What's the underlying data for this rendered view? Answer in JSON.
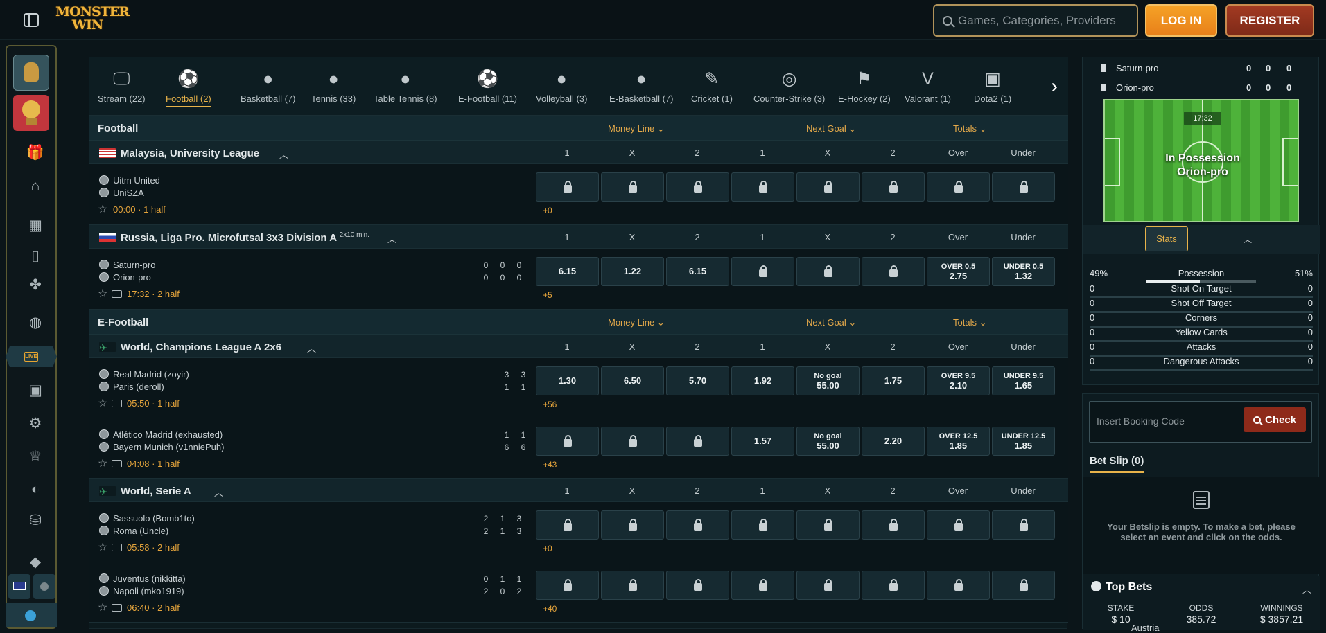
{
  "header": {
    "logo_line1": "MONSTER",
    "logo_line2": "WIN",
    "search_placeholder": "Games, Categories, Providers",
    "login": "LOG IN",
    "register": "REGISTER"
  },
  "sidebar": {
    "live": "LIVE"
  },
  "categories": [
    {
      "label": "Stream (22)",
      "icon": "tv-icon",
      "glyph": "🖵"
    },
    {
      "label": "Football (2)",
      "icon": "football-icon",
      "glyph": "⚽",
      "active": true
    },
    {
      "label": "Basketball (7)",
      "icon": "basketball-icon",
      "glyph": "●"
    },
    {
      "label": "Tennis (33)",
      "icon": "tennis-icon",
      "glyph": "●"
    },
    {
      "label": "Table Tennis (8)",
      "icon": "table-tennis-icon",
      "glyph": "●"
    },
    {
      "label": "E-Football (11)",
      "icon": "efootball-icon",
      "glyph": "⚽"
    },
    {
      "label": "Volleyball (3)",
      "icon": "volleyball-icon",
      "glyph": "●"
    },
    {
      "label": "E-Basketball (7)",
      "icon": "ebasketball-icon",
      "glyph": "●"
    },
    {
      "label": "Cricket (1)",
      "icon": "cricket-icon",
      "glyph": "✎"
    },
    {
      "label": "Counter-Strike (3)",
      "icon": "counter-strike-icon",
      "glyph": "◎"
    },
    {
      "label": "E-Hockey (2)",
      "icon": "ehockey-icon",
      "glyph": "⚑"
    },
    {
      "label": "Valorant (1)",
      "icon": "valorant-icon",
      "glyph": "V"
    },
    {
      "label": "Dota2 (1)",
      "icon": "dota2-icon",
      "glyph": "▣"
    }
  ],
  "markets": {
    "money_line": "Money Line",
    "next_goal": "Next Goal",
    "totals": "Totals"
  },
  "cols": [
    "1",
    "X",
    "2",
    "1",
    "X",
    "2",
    "Over",
    "Under"
  ],
  "sections": [
    {
      "title": "Football"
    },
    {
      "title": "E-Football"
    }
  ],
  "leagues": [
    {
      "name": "Malaysia, University League",
      "sub": ""
    },
    {
      "name": "Russia, Liga Pro. Microfutsal 3x3 Division A",
      "sub": "2x10 min."
    },
    {
      "name": "World, Champions League A 2x6",
      "sub": ""
    },
    {
      "name": "World, Serie A",
      "sub": ""
    }
  ],
  "events": [
    {
      "home": "Uitm United",
      "away": "UniSZA",
      "time": "00:00 · 1 half",
      "more": "+0",
      "sh": [],
      "sa": [],
      "odds": [
        "",
        "",
        "",
        "",
        "",
        "",
        "",
        ""
      ]
    },
    {
      "home": "Saturn-pro",
      "away": "Orion-pro",
      "time": "17:32 · 2 half",
      "more": "+5",
      "sh": [
        "0",
        "0",
        "0"
      ],
      "sa": [
        "0",
        "0",
        "0"
      ],
      "odds": [
        "6.15",
        "1.22",
        "6.15",
        "",
        "",
        "",
        "OVER 0.5|2.75",
        "UNDER 0.5|1.32"
      ]
    },
    {
      "home": "Real Madrid (zoyir)",
      "away": "Paris (deroll)",
      "time": "05:50 · 1 half",
      "more": "+56",
      "sh": [
        "3",
        "3"
      ],
      "sa": [
        "1",
        "1"
      ],
      "odds": [
        "1.30",
        "6.50",
        "5.70",
        "1.92",
        "No goal|55.00",
        "1.75",
        "OVER 9.5|2.10",
        "UNDER 9.5|1.65"
      ]
    },
    {
      "home": "Atlético Madrid (exhausted)",
      "away": "Bayern Munich (v1nniePuh)",
      "time": "04:08 · 1 half",
      "more": "+43",
      "sh": [
        "1",
        "1"
      ],
      "sa": [
        "6",
        "6"
      ],
      "odds": [
        "",
        "",
        "",
        "1.57",
        "No goal|55.00",
        "2.20",
        "OVER 12.5|1.85",
        "UNDER 12.5|1.85"
      ]
    },
    {
      "home": "Sassuolo (Bomb1to)",
      "away": "Roma (Uncle)",
      "time": "05:58 · 2 half",
      "more": "+0",
      "sh": [
        "2",
        "1",
        "3"
      ],
      "sa": [
        "2",
        "1",
        "3"
      ],
      "odds": [
        "",
        "",
        "",
        "",
        "",
        "",
        "",
        ""
      ]
    },
    {
      "home": "Juventus (nikkitta)",
      "away": "Napoli (mko1919)",
      "time": "06:40 · 2 half",
      "more": "+40",
      "sh": [
        "0",
        "1",
        "1"
      ],
      "sa": [
        "2",
        "0",
        "2"
      ],
      "odds": [
        "",
        "",
        "",
        "",
        "",
        "",
        "",
        ""
      ]
    }
  ],
  "tracker": {
    "home": "Saturn-pro",
    "away": "Orion-pro",
    "home_sc": [
      "0",
      "0",
      "0"
    ],
    "away_sc": [
      "0",
      "0",
      "0"
    ],
    "clock": "17:32",
    "possession_line1": "In Possession",
    "possession_line2": "Orion-pro",
    "stats_tab": "Stats",
    "possession": {
      "label": "Possession",
      "home": "49%",
      "away": "51%",
      "home_frac": 0.49
    },
    "stats": [
      {
        "label": "Shot On Target",
        "home": "0",
        "away": "0"
      },
      {
        "label": "Shot Off Target",
        "home": "0",
        "away": "0"
      },
      {
        "label": "Corners",
        "home": "0",
        "away": "0"
      },
      {
        "label": "Yellow Cards",
        "home": "0",
        "away": "0"
      },
      {
        "label": "Attacks",
        "home": "0",
        "away": "0"
      },
      {
        "label": "Dangerous Attacks",
        "home": "0",
        "away": "0"
      }
    ]
  },
  "booking": {
    "placeholder": "Insert Booking Code",
    "check": "Check"
  },
  "betslip": {
    "tab": "Bet Slip (0)",
    "empty": "Your Betslip is empty. To make a bet, please select an event and click on the odds."
  },
  "topbets": {
    "title": "Top Bets",
    "stake_label": "STAKE",
    "stake": "$ 10",
    "odds_label": "ODDS",
    "odds": "385.72",
    "win_label": "WINNINGS",
    "win": "$ 3857.21",
    "peek": "Austria"
  }
}
